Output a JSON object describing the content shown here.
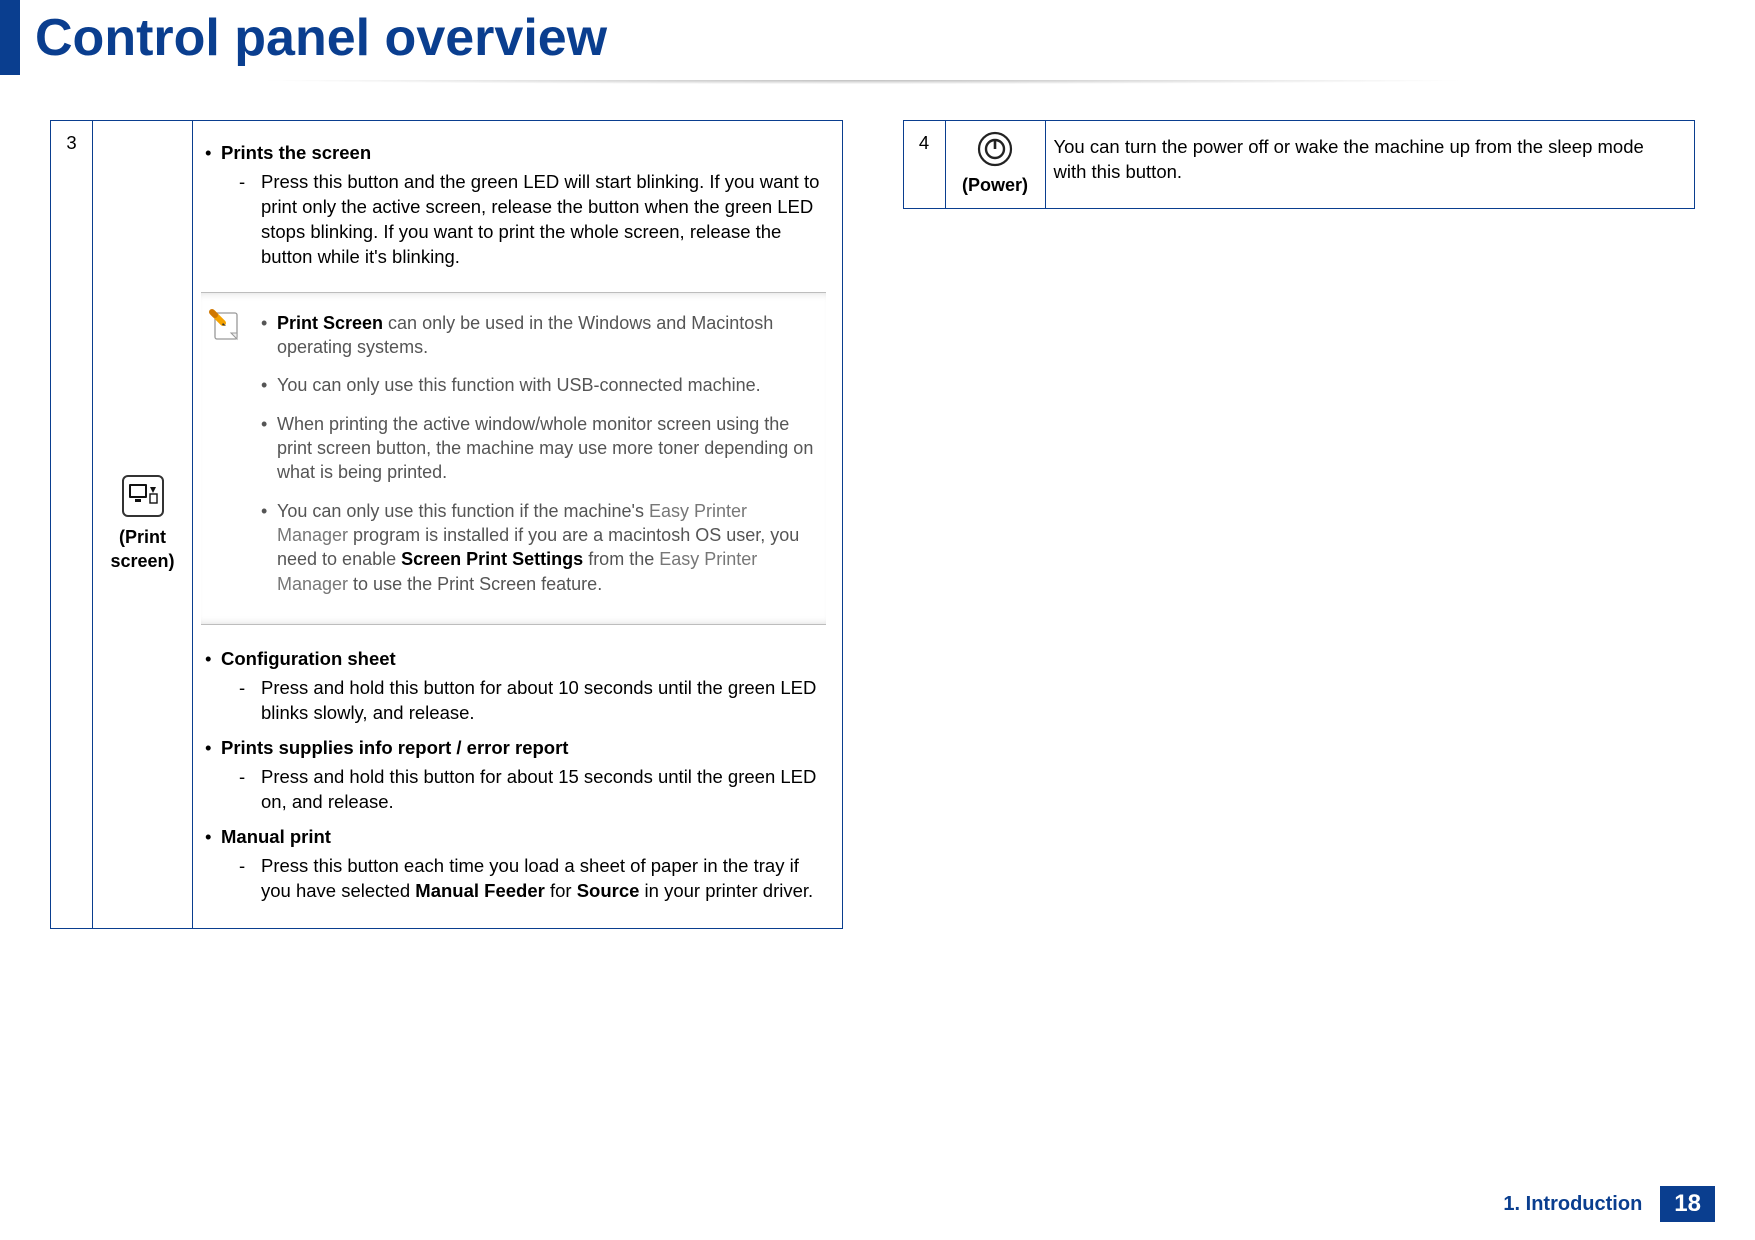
{
  "header": {
    "title": "Control panel overview"
  },
  "left": {
    "num": "3",
    "icon_label": "(Print screen)",
    "item1": {
      "title": "Prints the screen",
      "detail": "Press this button and the green LED will start blinking. If you want to print only the active screen, release the button when the green LED stops blinking. If you want to print the whole screen, release the button while it's blinking."
    },
    "note": {
      "n1a": "Print Screen",
      "n1b": " can only be used in the Windows and Macintosh operating systems.",
      "n2": "You can only use this function with USB-connected machine.",
      "n3": "When printing the active window/whole monitor screen using the print screen button, the machine may use more toner depending on what is being printed.",
      "n4a": "You can only use this function if the machine's ",
      "n4b": "Easy Printer Manager",
      "n4c": " program is installed if you are a macintosh OS user, you need to enable ",
      "n4d": "Screen Print Settings",
      "n4e": " from the ",
      "n4f": "Easy Printer Manager",
      "n4g": " to use the Print Screen feature."
    },
    "item2": {
      "title": "Configuration sheet",
      "detail": "Press and hold this button for about 10 seconds until the green LED blinks slowly, and release."
    },
    "item3": {
      "title": "Prints supplies info report / error report",
      "detail": "Press and hold this button for about 15 seconds until the green LED on, and release."
    },
    "item4": {
      "title": "Manual print",
      "d_a": "Press this button each time you load a sheet of paper in the tray if you have selected ",
      "d_b": "Manual Feeder",
      "d_c": " for ",
      "d_d": "Source",
      "d_e": " in your printer driver."
    }
  },
  "right": {
    "num": "4",
    "icon_label": "(Power)",
    "desc": "You can turn the power off or wake the machine up from the sleep mode with this button."
  },
  "footer": {
    "chapter": "1. Introduction",
    "page": "18"
  }
}
